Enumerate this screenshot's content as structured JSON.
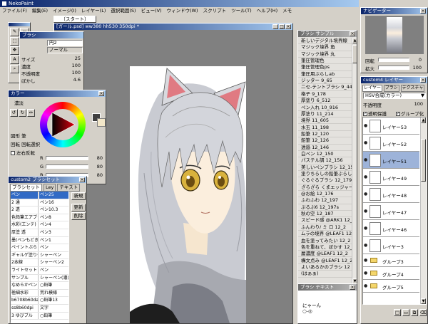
{
  "app": {
    "title": "NekoPaint"
  },
  "menu": [
    "ファイル(F)",
    "編集(E)",
    "イメージ(I)",
    "レイヤー(L)",
    "選択範囲(S)",
    "ビュー(V)",
    "ウィンドウ(W)",
    "スクリプト",
    "ツール(T)",
    "ヘルプ(H)",
    "メモ"
  ],
  "canvas_tab": "〔スタート〕",
  "canvas_window": {
    "title": "[ガール.psd] ww380 hh530 350dpi *"
  },
  "brush_panel": {
    "title": "ブラシ",
    "mode": "ノーマル",
    "size_label": "サイズ",
    "size": "25",
    "density_label": "濃度",
    "density": "100",
    "opacity_label": "不透明度",
    "opacity": "100",
    "blur_label": "ぼかし",
    "blur": "4.6",
    "name": "円2"
  },
  "color_panel": {
    "title": "カラー",
    "tab": "濃淡",
    "r_label": "R",
    "r": "80",
    "g_label": "G",
    "g": "80",
    "b_label": "B",
    "b": "80",
    "shape_label": "図形 筆",
    "edit_label": "回転 回転選択",
    "flip_label": "左右反転"
  },
  "brush_grid": {
    "title": "custom2 ブラシセット",
    "tabs": [
      "ブラシセット",
      "Ley",
      "テキスト"
    ],
    "col1": [
      "ペン",
      "2 通",
      "2 透",
      "色鉛筆エアブラシ",
      "水彩(エンテ)",
      "厚塗 透",
      "墨(ペンもどき",
      "ペイントぶらし",
      "ギャルゲ塗りセ",
      "2本線",
      "ライトセット",
      "サンプル",
      "なめらかペン",
      "極細水彩",
      "b6708b60dat",
      "ss8b60dpi",
      "3 ゆびブル"
    ],
    "col2": [
      "ペン25",
      "ペン16",
      "ペン10.3",
      "ペン8",
      "ペン4",
      "ペン3",
      "ペン1",
      "ペン",
      "シャーペン",
      "シャーペン2",
      "ペン",
      "シャーペン(濃)",
      "○鉛筆",
      "荒れ模様",
      "○鉛筆13",
      "文字",
      "○鉛筆"
    ],
    "buttons": [
      "新規",
      "更新",
      "削除"
    ]
  },
  "brush_sample": {
    "title": "ブラシ サンプル",
    "items": [
      "新しいデジタル境界線",
      "マジック境界 角",
      "マジック境界 丸",
      "筆圧管理色",
      "筆圧管理色ps",
      "筆圧用ぶらしab",
      "ジッター 9_65",
      "二セ-テントブラシ 9_44",
      "格子 9_178",
      "厚塗り 6_512",
      "ペン入れ 10_916",
      "厚塗り 11_214",
      "境界 11_605",
      "水玉 11_198",
      "鉛筆 12_120",
      "鉛筆 12_126",
      "透過 12_146",
      "白ペン 12_150",
      "パステル調 12_156",
      "美しいペンブラシ 12_157",
      "塗りちらしの鉛筆ぶらし",
      "ぐるぐるプラシ 12_179",
      "ざらざら くまエッジャー",
      "@お絵 12_176",
      "ふわふわ 12_197",
      "ぷるぷ6 12_197s",
      "秋の空 12_187",
      "スピード感 @ARK1 12_198",
      "ふんわり/ ミ ロ 12_2",
      "ムラの境界 @LEAF1 12_",
      "血を塗ってみたい 12_2",
      "色を重ねて、ぼかす 12_2",
      "層濃度 @LEAF1 12_2",
      "構文点み @LEAF1 12_2",
      "よいあるかのブラシ 12",
      "(はぁぁ)"
    ]
  },
  "text_panel": {
    "title": "ブラシ テキスト",
    "line1": "にゃーん",
    "line2": "○-◎"
  },
  "navigator": {
    "title": "ナビゲーター",
    "angle_label": "回転",
    "angle": "0",
    "zoom_label": "拡大",
    "zoom": "100"
  },
  "layer_panel": {
    "title": "custom4 レイヤー",
    "tabs": [
      "レイヤー",
      "ブラシ",
      "テクスチャ"
    ],
    "blend_mode": "HSV合成(カラー)",
    "opacity_label": "不透明度",
    "opacity": "100",
    "check_protect": "透明保護",
    "check_group": "グループ化",
    "layers": [
      {
        "name": "レイヤー53"
      },
      {
        "name": "レイヤー52"
      },
      {
        "name": "レイヤー51"
      },
      {
        "name": "レイヤー49"
      },
      {
        "name": "レイヤー48"
      },
      {
        "name": "レイヤー47"
      },
      {
        "name": "レイヤー46"
      },
      {
        "name": "レイヤー3"
      },
      {
        "name": "グループ3"
      },
      {
        "name": "グループ4"
      },
      {
        "name": "グループ5"
      }
    ]
  },
  "colors": {
    "window_gray": "#d4d0c8",
    "canvas_bg": "#808080",
    "titlebar": "#0a246a",
    "selected": "#316ac5"
  }
}
